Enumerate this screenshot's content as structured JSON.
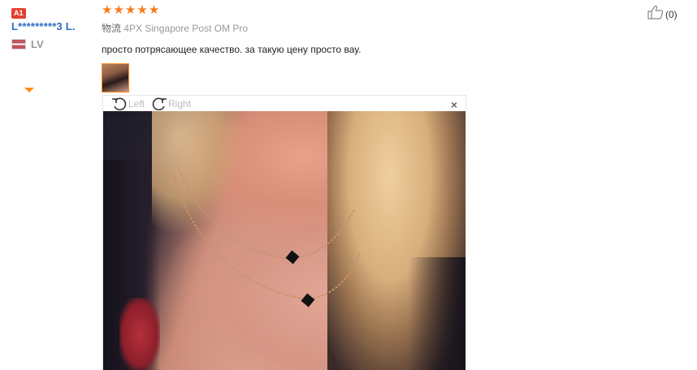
{
  "user": {
    "badge": "A1",
    "name": "L*********3 L.",
    "country_code": "LV"
  },
  "review": {
    "rating": 5,
    "stars": [
      "★",
      "★",
      "★",
      "★",
      "★"
    ],
    "shipping_label": "物流",
    "shipping_method": "4PX Singapore Post OM Pro",
    "text": "просто потрясающее качество. за такую цену просто вау."
  },
  "helpful": {
    "count": "(0)"
  },
  "viewer": {
    "rotate_left": "Left",
    "rotate_right": "Right",
    "close": "×"
  },
  "colors": {
    "star": "#fb7a18",
    "username": "#2b6cc4",
    "thumb_border": "#ff8c1a",
    "badge": "#e43f2f"
  },
  "icons": {
    "helpful": "thumbs-up-icon",
    "rotate_left": "rotate-left-icon",
    "rotate_right": "rotate-right-icon",
    "close": "close-icon"
  }
}
